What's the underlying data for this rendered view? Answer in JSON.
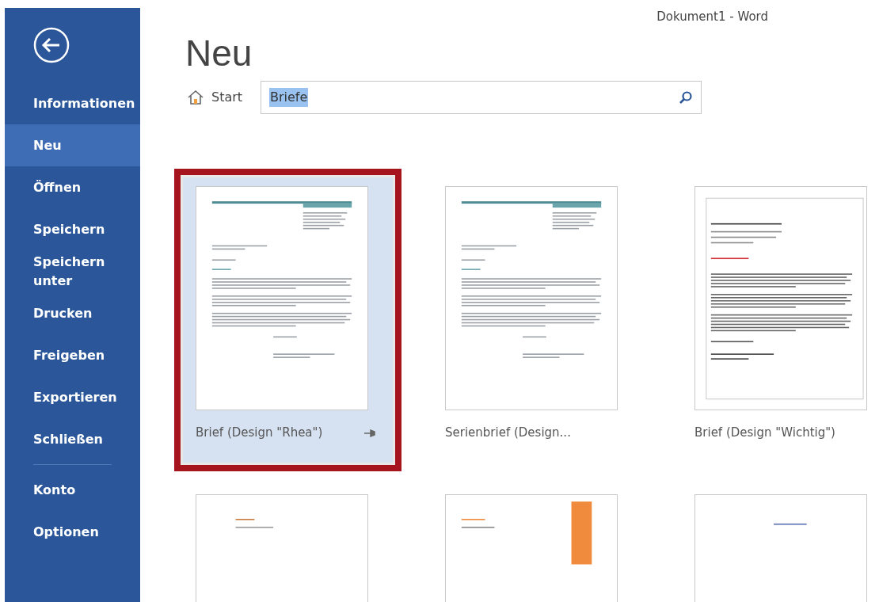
{
  "window": {
    "title": "Dokument1 - Word"
  },
  "sidebar": {
    "items": [
      {
        "label": "Informationen",
        "selected": false
      },
      {
        "label": "Neu",
        "selected": true
      },
      {
        "label": "Öffnen",
        "selected": false
      },
      {
        "label": "Speichern",
        "selected": false
      },
      {
        "label": "Speichern unter",
        "selected": false
      },
      {
        "label": "Drucken",
        "selected": false
      },
      {
        "label": "Freigeben",
        "selected": false
      },
      {
        "label": "Exportieren",
        "selected": false
      },
      {
        "label": "Schließen",
        "selected": false
      }
    ],
    "footer_items": [
      {
        "label": "Konto",
        "selected": false
      },
      {
        "label": "Optionen",
        "selected": false
      }
    ]
  },
  "page": {
    "title": "Neu"
  },
  "breadcrumb": {
    "label": "Start"
  },
  "search": {
    "value": "Briefe",
    "value_selected": true
  },
  "templates": [
    {
      "name": "Brief (Design \"Rhea\")",
      "selected": true,
      "kind": "rhea"
    },
    {
      "name": "Serienbrief (Design...",
      "selected": false,
      "kind": "rhea"
    },
    {
      "name": "Brief (Design \"Wichtig\")",
      "selected": false,
      "kind": "wichtig"
    },
    {
      "selected": false,
      "kind": "plain"
    },
    {
      "selected": false,
      "kind": "orange"
    },
    {
      "selected": false,
      "kind": "blue"
    }
  ]
}
